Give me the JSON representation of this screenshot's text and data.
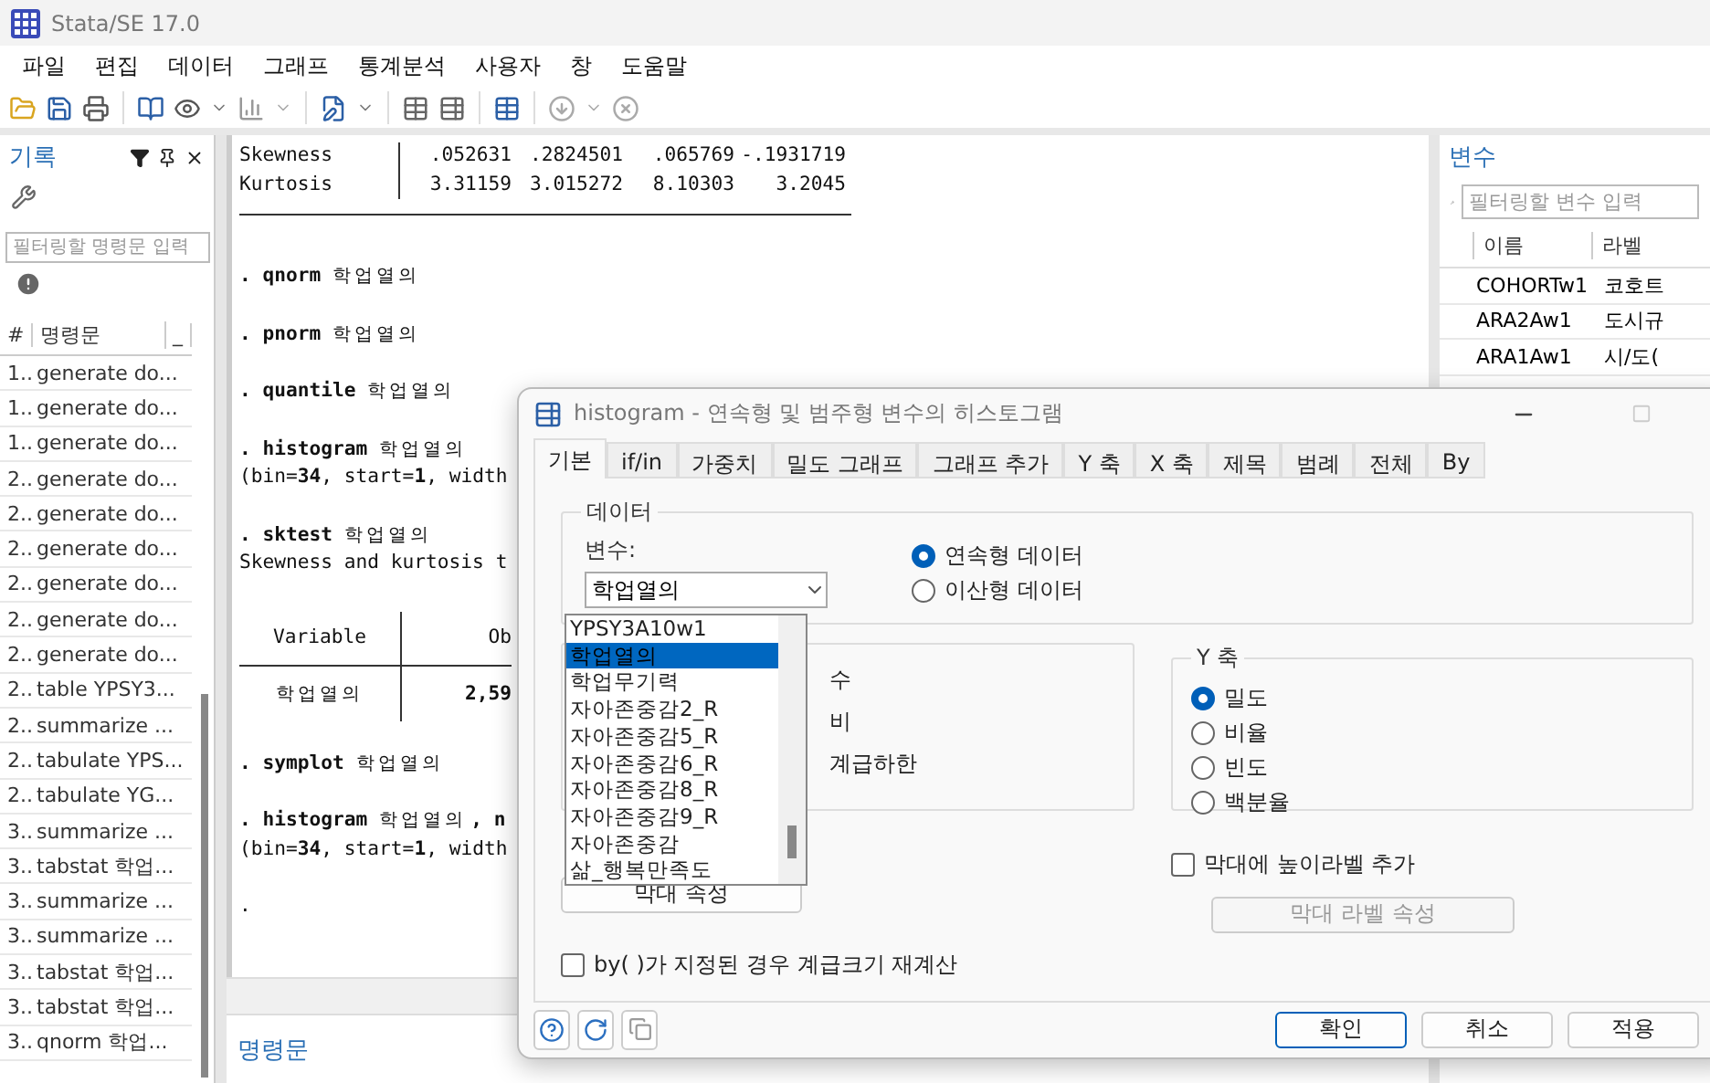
{
  "window": {
    "title": "Stata/SE 17.0"
  },
  "menu": [
    "파일",
    "편집",
    "데이터",
    "그래프",
    "통계분석",
    "사용자",
    "창",
    "도움말"
  ],
  "history": {
    "title": "기록",
    "filter_placeholder": "필터링할 명령문 입력",
    "columns": [
      "#",
      "명령문",
      "_"
    ],
    "rows": [
      {
        "num": "1..",
        "command": "generate do..."
      },
      {
        "num": "1..",
        "command": "generate do..."
      },
      {
        "num": "1..",
        "command": "generate do..."
      },
      {
        "num": "2..",
        "command": "generate do..."
      },
      {
        "num": "2..",
        "command": "generate do..."
      },
      {
        "num": "2..",
        "command": "generate do..."
      },
      {
        "num": "2..",
        "command": "generate do..."
      },
      {
        "num": "2..",
        "command": "generate do..."
      },
      {
        "num": "2..",
        "command": "generate do..."
      },
      {
        "num": "2..",
        "command": "table YPSY3..."
      },
      {
        "num": "2..",
        "command": "summarize ..."
      },
      {
        "num": "2..",
        "command": "tabulate YPS..."
      },
      {
        "num": "2..",
        "command": "tabulate YG..."
      },
      {
        "num": "3..",
        "command": "summarize ..."
      },
      {
        "num": "3..",
        "command": "tabstat 학업..."
      },
      {
        "num": "3..",
        "command": "summarize ..."
      },
      {
        "num": "3..",
        "command": "summarize ..."
      },
      {
        "num": "3..",
        "command": "tabstat 학업..."
      },
      {
        "num": "3..",
        "command": "tabstat 학업..."
      },
      {
        "num": "3..",
        "command": "qnorm 학업..."
      }
    ]
  },
  "results": [
    {
      "kind": "stat",
      "label": "Skewness",
      "values": [
        ".052631",
        ".2824501",
        ".065769",
        "-.1931719"
      ]
    },
    {
      "kind": "stat",
      "label": "Kurtosis",
      "values": [
        "3.31159",
        "3.015272",
        "8.10303",
        "3.2045"
      ]
    },
    {
      "kind": "command",
      "command": ". qnorm",
      "arg": "학업열의"
    },
    {
      "kind": "command",
      "command": ". pnorm",
      "arg": "학업열의"
    },
    {
      "kind": "command",
      "command": ". quantile",
      "arg": "학업열의"
    },
    {
      "kind": "command",
      "command": ". histogram",
      "arg": "학업열의"
    },
    {
      "kind": "output",
      "text": "(bin=**34**, start=**1**, width"
    },
    {
      "kind": "command",
      "command": ". sktest",
      "arg": "학업열의"
    },
    {
      "kind": "output",
      "text": "Skewness and kurtosis t"
    },
    {
      "kind": "table",
      "header": [
        "Variable",
        "Ob"
      ],
      "row": [
        "학업열의",
        "2,59"
      ]
    },
    {
      "kind": "command",
      "command": ". symplot",
      "arg": "학업열의"
    },
    {
      "kind": "command",
      "command": ". histogram",
      "arg": "학업열의",
      "options": ", n"
    },
    {
      "kind": "output",
      "text": "(bin=**34**, start=**1**, width"
    },
    {
      "kind": "prompt",
      "text": "."
    }
  ],
  "command_panel": {
    "title": "명령문"
  },
  "variables": {
    "title": "변수",
    "filter_placeholder": "필터링할 변수 입력",
    "columns": [
      "이름",
      "라벨"
    ],
    "rows": [
      {
        "name": "COHORTw1",
        "label": "코호트"
      },
      {
        "name": "ARA2Aw1",
        "label": "도시규"
      },
      {
        "name": "ARA1Aw1",
        "label": "시/도("
      }
    ]
  },
  "dialog": {
    "title": "histogram - 연속형 및 범주형 변수의 히스토그램",
    "tabs": [
      {
        "label": "기본",
        "selected": true
      },
      {
        "label": "if/in",
        "selected": false
      },
      {
        "label": "가중치",
        "selected": false
      },
      {
        "label": "밀도 그래프",
        "selected": false
      },
      {
        "label": "그래프 추가",
        "selected": false
      },
      {
        "label": "Y 축",
        "selected": false
      },
      {
        "label": "X 축",
        "selected": false
      },
      {
        "label": "제목",
        "selected": false
      },
      {
        "label": "범례",
        "selected": false
      },
      {
        "label": "전체",
        "selected": false
      },
      {
        "label": "By",
        "selected": false
      }
    ],
    "data_group": {
      "title": "데이터",
      "variable_label": "변수:",
      "variable_value": "학업열의",
      "dropdown_items": [
        {
          "label": "YPSY3A10w1",
          "selected": false
        },
        {
          "label": "학업열의",
          "selected": true
        },
        {
          "label": "학업무기력",
          "selected": false
        },
        {
          "label": "자아존중감2_R",
          "selected": false
        },
        {
          "label": "자아존중감5_R",
          "selected": false
        },
        {
          "label": "자아존중감6_R",
          "selected": false
        },
        {
          "label": "자아존중감8_R",
          "selected": false
        },
        {
          "label": "자아존중감9_R",
          "selected": false
        },
        {
          "label": "자아존중감",
          "selected": false
        },
        {
          "label": "삶_행복만족도",
          "selected": false
        }
      ],
      "data_types": [
        {
          "label": "연속형 데이터",
          "selected": true
        },
        {
          "label": "이산형 데이터",
          "selected": false
        }
      ]
    },
    "bins_fragments": [
      "수",
      "비",
      "계급하한"
    ],
    "bar_button": "막대 속성",
    "y_axis": {
      "title": "Y 축",
      "options": [
        {
          "label": "밀도",
          "selected": true
        },
        {
          "label": "비율",
          "selected": false
        },
        {
          "label": "빈도",
          "selected": false
        },
        {
          "label": "백분율",
          "selected": false
        }
      ]
    },
    "height_labels": {
      "label": "막대에 높이라벨 추가",
      "checked": false
    },
    "bar_label_button": {
      "label": "막대 라벨 속성",
      "disabled": true
    },
    "recalc": {
      "label": "by( )가 지정된 경우 계급크기 재계산",
      "checked": false
    },
    "buttons": [
      {
        "label": "확인",
        "default": true
      },
      {
        "label": "취소",
        "default": false
      },
      {
        "label": "적용",
        "default": false
      }
    ]
  }
}
